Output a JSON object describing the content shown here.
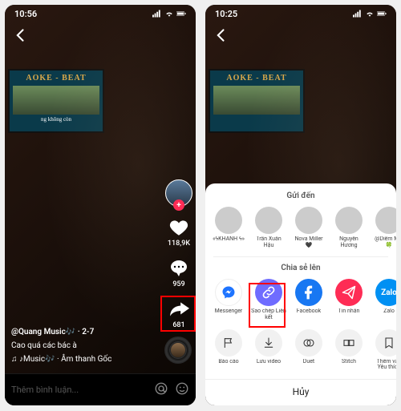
{
  "left": {
    "status_time": "10:56",
    "tv_title": "AOKE - BEAT",
    "tv_sub": "ng không còn",
    "user": "@Quang Music🎶 · 2-7",
    "desc": "Cao quá các bác à",
    "sound": "♫ ♪Music🎶 · Âm thanh Gốc",
    "likes": "118,9K",
    "comments": "959",
    "shares": "681",
    "comment_ph": "Thêm bình luận..."
  },
  "right": {
    "status_time": "10:25",
    "tv_title": "AOKE - BEAT",
    "send_to": "Gửi đến",
    "share_to": "Chia sẻ lên",
    "contacts": [
      {
        "name": "«ϟKHANH ϟ»"
      },
      {
        "name": "Trần Xuân Hậu"
      },
      {
        "name": "Nova Miller 🖤"
      },
      {
        "name": "Nguyễn Hương"
      },
      {
        "name": "@Diễm Min 🍀"
      }
    ],
    "apps": [
      {
        "name": "Messenger",
        "bg": "#ffffff",
        "stroke": "#1e74ff"
      },
      {
        "name": "Sao chép Liên kết",
        "bg": "#6f6cff"
      },
      {
        "name": "Facebook",
        "bg": "#1877f2"
      },
      {
        "name": "Tin nhắn",
        "bg": "#fe2c55"
      },
      {
        "name": "Zalo",
        "bg": "#0190f3"
      }
    ],
    "actions": [
      {
        "name": "Báo cáo"
      },
      {
        "name": "Lưu video"
      },
      {
        "name": "Duet"
      },
      {
        "name": "Stitch"
      },
      {
        "name": "Thêm vào Yêu thích"
      }
    ],
    "cancel": "Hủy"
  }
}
